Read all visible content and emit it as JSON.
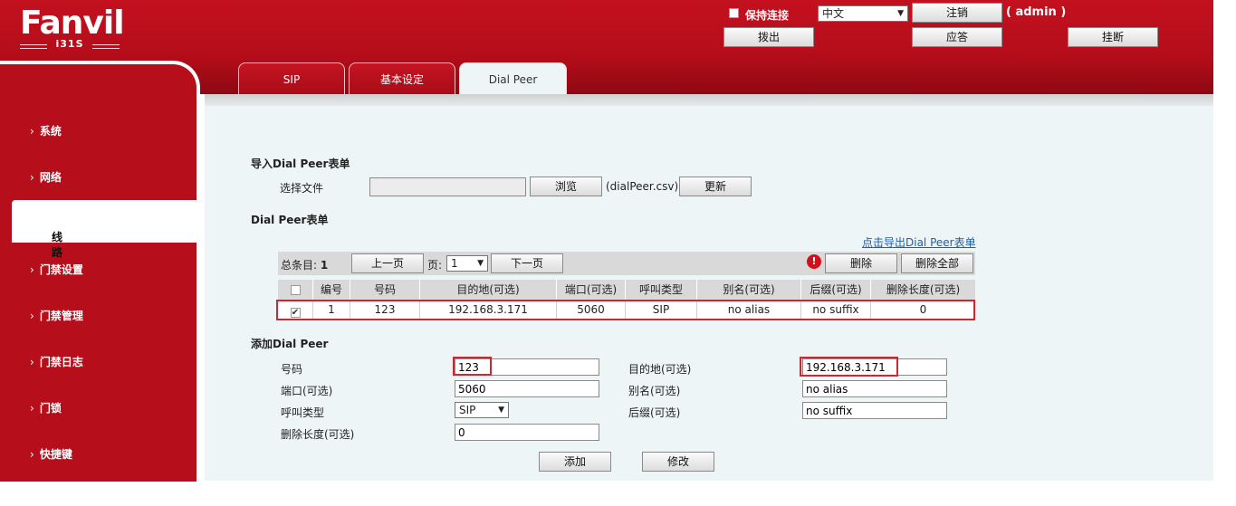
{
  "brand": {
    "logo": "Fanvil",
    "model": "i31S"
  },
  "header": {
    "keep_online_label": "保持连接",
    "language": "中文",
    "logout_label": "注销",
    "user_label": "( admin )",
    "dial_out_label": "拨出",
    "answer_label": "应答",
    "hangup_label": "挂断"
  },
  "sidebar": {
    "items": [
      {
        "label": "系统"
      },
      {
        "label": "网络"
      },
      {
        "label": "线路"
      },
      {
        "label": "门禁设置"
      },
      {
        "label": "门禁管理"
      },
      {
        "label": "门禁日志"
      },
      {
        "label": "门锁"
      },
      {
        "label": "快捷键"
      }
    ],
    "active_index": 2
  },
  "tabs": [
    {
      "label": "SIP"
    },
    {
      "label": "基本设定"
    },
    {
      "label": "Dial Peer"
    }
  ],
  "import_section": {
    "title": "导入Dial Peer表单",
    "choose_file_label": "选择文件",
    "browse_label": "浏览",
    "file_hint": "(dialPeer.csv)",
    "update_label": "更新"
  },
  "table_section": {
    "title": "Dial Peer表单",
    "export_link": "点击导出Dial Peer表单",
    "total_label": "总条目:",
    "total_value": "1",
    "prev_label": "上一页",
    "page_label": "页:",
    "page_value": "1",
    "next_label": "下一页",
    "delete_label": "删除",
    "delete_all_label": "删除全部",
    "columns": [
      "编号",
      "号码",
      "目的地(可选)",
      "端口(可选)",
      "呼叫类型",
      "别名(可选)",
      "后缀(可选)",
      "删除长度(可选)"
    ],
    "rows": [
      {
        "checked": true,
        "no": "1",
        "number": "123",
        "destination": "192.168.3.171",
        "port": "5060",
        "call_type": "SIP",
        "alias": "no alias",
        "suffix": "no suffix",
        "delete_length": "0"
      }
    ]
  },
  "add_section": {
    "title": "添加Dial Peer",
    "number_label": "号码",
    "number_value": "123",
    "destination_label": "目的地(可选)",
    "destination_value": "192.168.3.171",
    "port_label": "端口(可选)",
    "port_value": "5060",
    "alias_label": "别名(可选)",
    "alias_value": "no alias",
    "call_type_label": "呼叫类型",
    "call_type_value": "SIP",
    "suffix_label": "后缀(可选)",
    "suffix_value": "no suffix",
    "delete_length_label": "删除长度(可选)",
    "delete_length_value": "0",
    "add_label": "添加",
    "modify_label": "修改"
  },
  "colors": {
    "brand_red": "#b70e1b",
    "highlight_red": "#d8232f",
    "link_blue": "#1d5fa8",
    "content_bg": "#eef5f7"
  }
}
